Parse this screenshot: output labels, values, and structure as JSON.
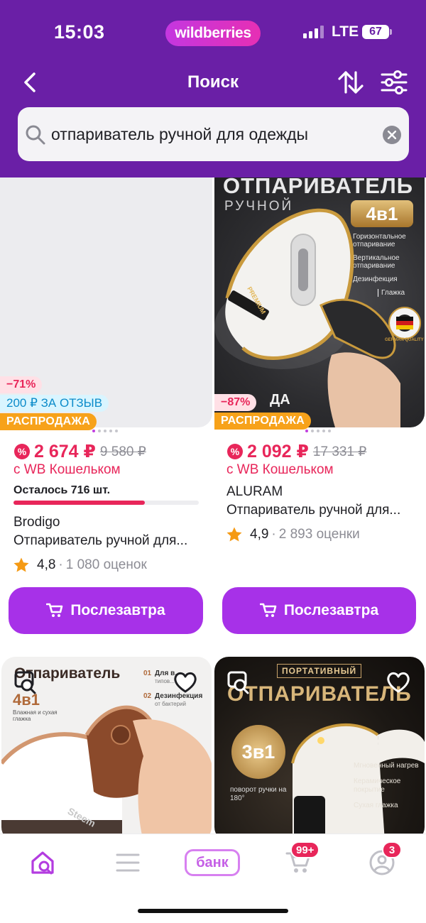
{
  "status_bar": {
    "time": "15:03",
    "app_pill": "wildberries",
    "network": "LTE",
    "battery": "67"
  },
  "header": {
    "title": "Поиск",
    "back_icon": "chevron-left-icon",
    "sort_icon": "sort-arrows-icon",
    "filter_icon": "sliders-icon"
  },
  "search": {
    "value": "отпариватель ручной для одежды"
  },
  "products": [
    {
      "discount": "−71%",
      "review_bonus": "200 ₽ ЗА ОТЗЫВ",
      "sale_label": "РАСПРОДАЖА",
      "price": "2 674 ₽",
      "old_price": "9 580 ₽",
      "wallet": "с WB Кошельком",
      "stock": "Осталось 716 шт.",
      "stock_level": 0.71,
      "brand": "Brodigo",
      "name": "Отпариватель ручной для...",
      "rating": "4,8",
      "reviews": "1 080 оценок",
      "button": "Послезавтра"
    },
    {
      "discount": "−87%",
      "sale_label": "РАСПРОДАЖА",
      "price": "2 092 ₽",
      "old_price": "17 331 ₽",
      "wallet": "с WB Кошельком",
      "brand": "ALURAM",
      "name": "Отпариватель ручной для...",
      "rating": "4,9",
      "reviews": "2 893 оценки",
      "button": "Послезавтра",
      "image_text": {
        "title": "ОТПАРИВАТЕЛЬ",
        "subtitle": "РУЧНОЙ",
        "badge": "4в1",
        "features": [
          "Горизонтальное отпаривание",
          "Вертикальное отпаривание",
          "Дезинфекция",
          "Глажка"
        ],
        "seal": "GERMAN QUALITY",
        "handle_label": "PREMIUM",
        "bottom_partial": "ДА"
      }
    },
    {
      "image_text": {
        "title": "Отпариватель",
        "badge": "4в1",
        "badge_caption": "Влажная и сухая глажка",
        "feature_1_no": "01",
        "feature_1": "Для в...",
        "feature_1_sub": "типов...",
        "feature_2_no": "02",
        "feature_2": "Дезинфекция",
        "feature_2_sub": "от бактерий",
        "product_brand": "Steem"
      }
    },
    {
      "image_text": {
        "tag": "ПОРТАТИВНЫЙ",
        "title": "ОТПАРИВАТЕЛЬ",
        "badge": "3в1",
        "caption": "поворот ручки на 180°",
        "features": [
          "Мгновенный нагрев",
          "Керамическое покрытие",
          "Сухая глажка"
        ]
      }
    }
  ],
  "tabbar": {
    "bank_label": "банк",
    "cart_badge": "99+",
    "profile_badge": "3"
  },
  "colors": {
    "header_bg": "#6a1fa6",
    "accent": "#a731e8",
    "price": "#e8265a",
    "sale": "#f7a21a"
  }
}
